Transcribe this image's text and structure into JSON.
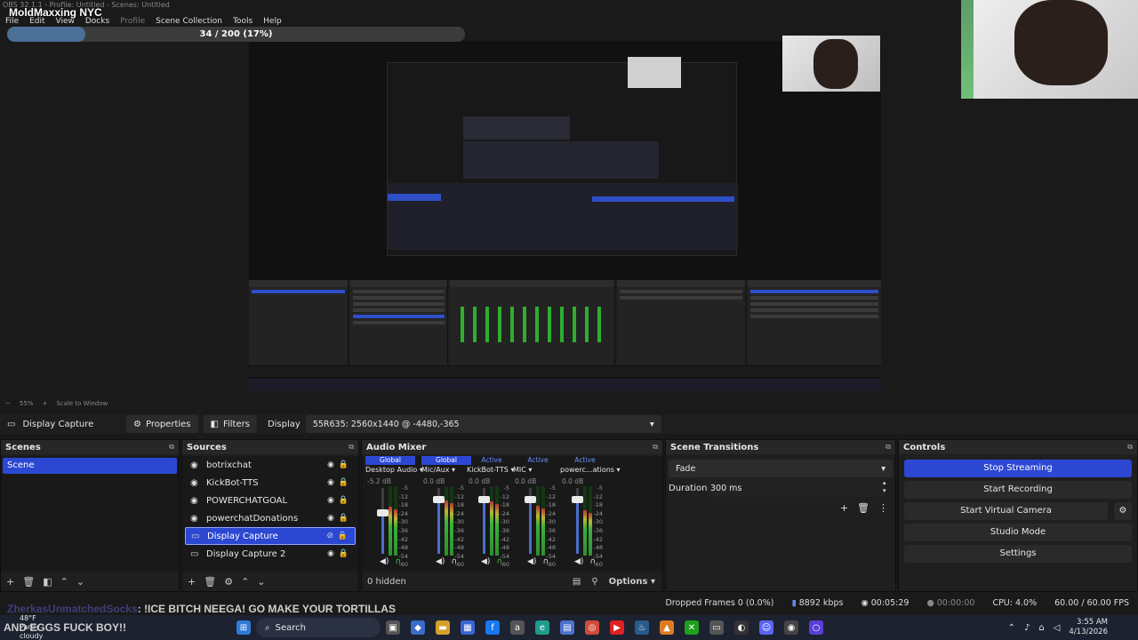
{
  "window": {
    "title": "OBS 32.1.1 - Profile: Untitled - Scenes: Untitled"
  },
  "overlay": {
    "channel_title": "MoldMaxxing NYC",
    "progress_text": "34 / 200 (17%)",
    "progress_fraction": 0.17
  },
  "menu": {
    "items": [
      "File",
      "Edit",
      "View",
      "Docks",
      "Profile",
      "Scene Collection",
      "Tools",
      "Help"
    ]
  },
  "zoom": {
    "level": "55%",
    "mode": "Scale to Window"
  },
  "context_bar": {
    "source_name": "Display Capture",
    "properties_label": "Properties",
    "filters_label": "Filters",
    "display_label": "Display",
    "display_value": "55R635: 2560x1440 @ -4480,-365"
  },
  "scenes": {
    "title": "Scenes",
    "items": [
      "Scene"
    ]
  },
  "sources": {
    "title": "Sources",
    "items": [
      {
        "name": "botrixchat",
        "icon": "browser-icon"
      },
      {
        "name": "KickBot-TTS",
        "icon": "browser-icon"
      },
      {
        "name": "POWERCHATGOAL",
        "icon": "browser-icon"
      },
      {
        "name": "powerchatDonations",
        "icon": "browser-icon"
      },
      {
        "name": "Display Capture",
        "icon": "monitor-icon",
        "selected": true
      },
      {
        "name": "Display Capture 2",
        "icon": "monitor-icon"
      }
    ]
  },
  "mixer": {
    "title": "Audio Mixer",
    "hidden_label": "0 hidden",
    "options_label": "Options",
    "scale": [
      "-5",
      "-12",
      "-18",
      "-24",
      "-30",
      "-36",
      "-42",
      "-48",
      "-54",
      "-60"
    ],
    "channels": [
      {
        "badge": "Global",
        "name": "Desktop Audio",
        "db": "-5.2 dB",
        "fader": 0.62,
        "level": 0.7,
        "headphone": true
      },
      {
        "badge": "Global",
        "name": "Mic/Aux",
        "db": "0.0 dB",
        "fader": 0.82,
        "level": 0.8,
        "headphone": false
      },
      {
        "badge": "Active",
        "name": "KickBot-TTS",
        "db": "0.0 dB",
        "fader": 0.82,
        "level": 0.78,
        "headphone": true
      },
      {
        "badge": "Active",
        "name": "MIC",
        "db": "0.0 dB",
        "fader": 0.82,
        "level": 0.72,
        "headphone": false
      },
      {
        "badge": "Active",
        "name": "powerc...ations",
        "db": "0.0 dB",
        "fader": 0.82,
        "level": 0.65,
        "headphone": false
      }
    ]
  },
  "transitions": {
    "title": "Scene Transitions",
    "value": "Fade",
    "duration_label": "Duration",
    "duration_value": "300 ms"
  },
  "controls": {
    "title": "Controls",
    "buttons": [
      "Stop Streaming",
      "Start Recording",
      "Start Virtual Camera",
      "Studio Mode",
      "Settings"
    ]
  },
  "status": {
    "dropped": "Dropped Frames 0 (0.0%)",
    "bitrate": "8892 kbps",
    "stream_time": "00:05:29",
    "rec_time": "00:00:00",
    "cpu": "CPU: 4.0%",
    "fps": "60.00 / 60.00 FPS"
  },
  "chat": {
    "user": "ZherkasUnmatchedSocks",
    "message": ": !ICE BITCH NEEGA! GO MAKE YOUR TORTILLAS",
    "line2": "AND EGGS FUCK BOY!!"
  },
  "taskbar": {
    "weather_temp": "48°F",
    "weather_desc": "Partly cloudy",
    "search": "Search",
    "time": "3:55 AM",
    "date": "4/13/2026"
  },
  "colors": {
    "accent": "#2c48d3",
    "meter_green": "#38b238",
    "bg": "#1a1a1a"
  }
}
